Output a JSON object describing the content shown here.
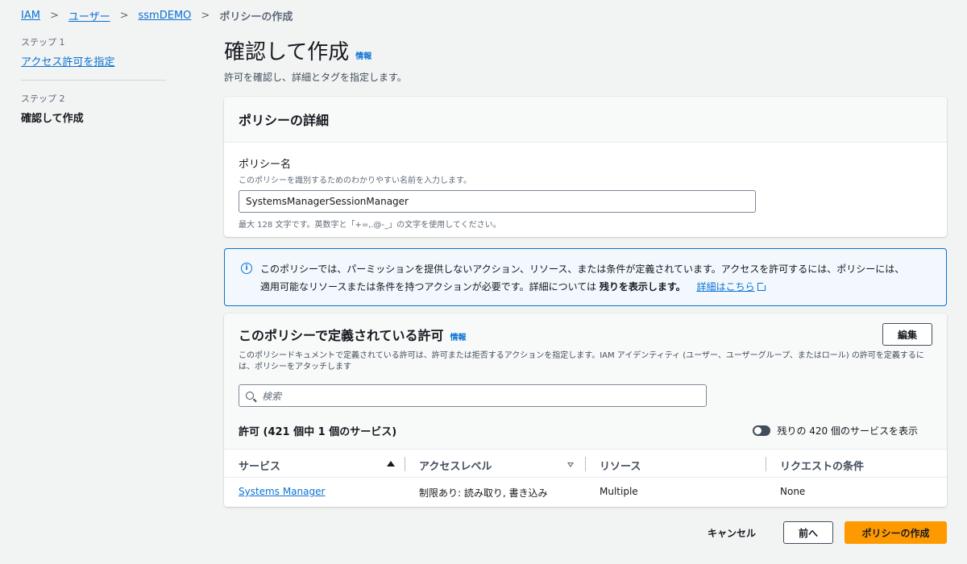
{
  "breadcrumb": {
    "items": [
      "IAM",
      "ユーザー",
      "ssmDEMO"
    ],
    "current": "ポリシーの作成"
  },
  "steps": {
    "step1_label": "ステップ 1",
    "step1_link": "アクセス許可を指定",
    "step2_label": "ステップ 2",
    "step2_current": "確認して作成"
  },
  "header": {
    "title": "確認して作成",
    "info": "情報",
    "subtitle": "許可を確認し、詳細とタグを指定します。"
  },
  "details": {
    "title": "ポリシーの詳細",
    "name_label": "ポリシー名",
    "name_desc": "このポリシーを識別するためのわかりやすい名前を入力します。",
    "name_value": "SystemsManagerSessionManager",
    "name_hint": "最大 128 文字です。英数字と「+=,.@-_」の文字を使用してください。"
  },
  "alert": {
    "text1": "このポリシーでは、パーミッションを提供しないアクション、リソース、または条件が定義されています。アクセスを許可するには、ポリシーには、",
    "text2": "適用可能なリソースまたは条件を持つアクションが必要です。詳細については ",
    "bold": "残りを表示します。",
    "link": "詳細はこちら"
  },
  "permissions": {
    "title": "このポリシーで定義されている許可",
    "info": "情報",
    "edit": "編集",
    "desc": "このポリシードキュメントで定義されている許可は、許可または拒否するアクションを指定します。IAM アイデンティティ (ユーザー、ユーザーグループ、またはロール) の許可を定義するには、ポリシーをアタッチします",
    "search_placeholder": "検索",
    "count": "許可 (421 個中 1 個のサービス)",
    "toggle_label": "残りの 420 個のサービスを表示",
    "columns": [
      "サービス",
      "アクセスレベル",
      "リソース",
      "リクエストの条件"
    ],
    "rows": [
      {
        "service": "Systems Manager",
        "access": "制限あり: 読み取り, 書き込み",
        "resource": "Multiple",
        "condition": "None"
      }
    ]
  },
  "footer": {
    "cancel": "キャンセル",
    "prev": "前へ",
    "create": "ポリシーの作成"
  }
}
